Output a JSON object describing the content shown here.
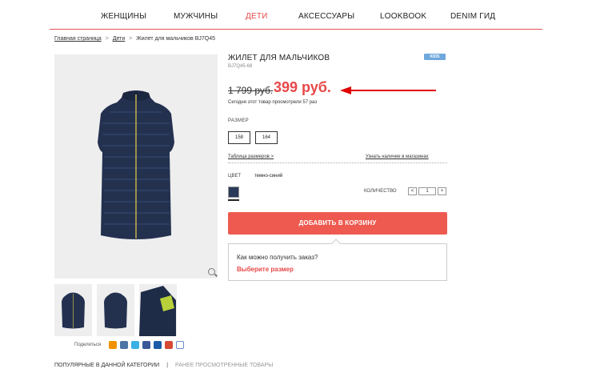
{
  "nav": {
    "items": [
      "ЖЕНЩИНЫ",
      "МУЖЧИНЫ",
      "ДЕТИ",
      "АКСЕССУАРЫ",
      "LOOKBOOK",
      "DENIM ГИД"
    ],
    "active_index": 2
  },
  "breadcrumb": {
    "home": "Главная страница",
    "category": "Дети",
    "current": "Жилет для мальчиков BJ7Q45"
  },
  "product": {
    "title": "ЖИЛЕТ ДЛЯ МАЛЬЧИКОВ",
    "sku": "BJ7Q45-68",
    "badge": "KIDS",
    "old_price": "1 799 руб.",
    "new_price": "399 руб.",
    "views_text": "Сегодня этот товар просмотрели 57 раз",
    "size_label": "РАЗМЕР",
    "sizes": [
      "158",
      "164"
    ],
    "size_table_link": "Таблица размеров >",
    "stores_link": "Узнать наличие в магазинах",
    "color_label": "ЦВЕТ",
    "color_value": "темно-синий",
    "quantity_label": "КОЛИЧЕСТВО",
    "quantity": "1",
    "qty_minus": "<",
    "qty_plus": "+",
    "add_to_cart": "ДОБАВИТЬ В КОРЗИНУ"
  },
  "delivery": {
    "question": "Как можно получить заказ?",
    "action": "Выберите размер"
  },
  "share": {
    "label": "Поделиться",
    "icons": [
      "odnoklassniki-icon",
      "vk-icon",
      "twitter-icon",
      "facebook-icon",
      "mailru-icon",
      "googleplus-icon",
      "email-icon"
    ]
  },
  "bottom_tabs": {
    "popular": "ПОПУЛЯРНЫЕ В ДАННОЙ КАТЕГОРИИ",
    "divider": "|",
    "recent": "РАНЕЕ ПРОСМОТРЕННЫЕ ТОВАРЫ"
  },
  "colors": {
    "accent": "#e84848",
    "button": "#ee5a50",
    "badge": "#6fa8dc",
    "swatch": "#2a3a58"
  }
}
